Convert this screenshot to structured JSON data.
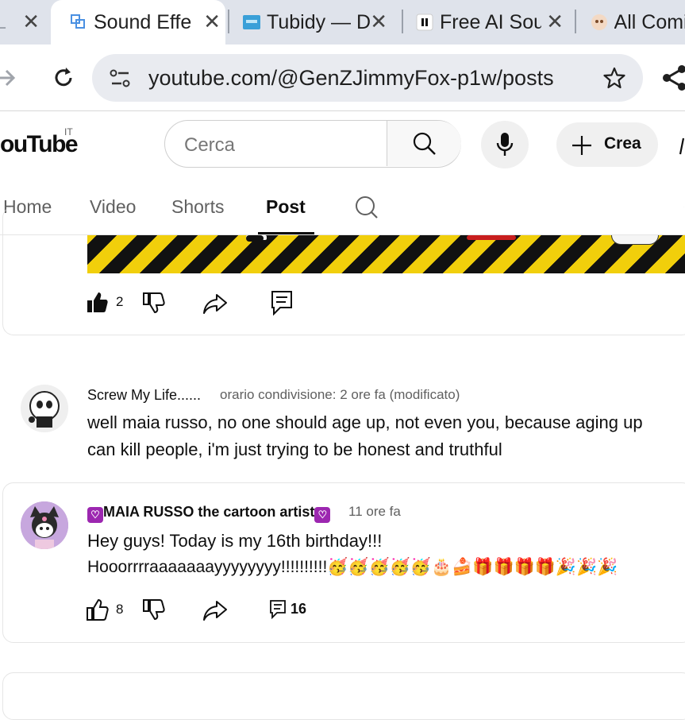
{
  "browser": {
    "tabs": [
      {
        "label": "L",
        "favicon": "partial-tab-icon"
      },
      {
        "label": "Sound Effe",
        "favicon": "sound-effects-favicon"
      },
      {
        "label": "Tubidy — D",
        "favicon": "tubidy-favicon"
      },
      {
        "label": "Free AI Sou",
        "favicon": "pause-favicon"
      },
      {
        "label": "All Comi",
        "favicon": "all-comics-favicon"
      }
    ],
    "close_glyph": "✕",
    "url": "youtube.com/@GenZJimmyFox-p1w/posts"
  },
  "youtube": {
    "logo_text": "ouTube",
    "country_code": "IT",
    "search_placeholder": "Cerca",
    "create_label": "Crea"
  },
  "channel_tabs": [
    {
      "label": "Home",
      "active": false
    },
    {
      "label": "Video",
      "active": false
    },
    {
      "label": "Shorts",
      "active": false
    },
    {
      "label": "Post",
      "active": true
    }
  ],
  "posts": [
    {
      "likes": "2"
    },
    {
      "author": "Screw My Life......",
      "meta": "orario condivisione: 2 ore fa (modificato)",
      "lines": [
        "well maia russo, no one should age up, not even you, because aging up",
        "can kill people, i'm just trying to be honest and truthful"
      ]
    },
    {
      "author": "MAIA RUSSO the cartoon artist",
      "meta": "11 ore fa",
      "lines": [
        "Hey guys! Today is my 16th birthday!!!",
        "Hooorrrraaaaaaayyyyyyyy!!!!!!!!!!🥳🥳🥳🥳🥳🎂🍰🎁🎁🎁🎁🎉🎉🎉"
      ],
      "likes": "8",
      "comments": "16"
    }
  ],
  "colors": {
    "tabstrip": "#dfe3eb",
    "omnibox": "#e9ebf0",
    "stripe_yellow": "#f1cf0b",
    "stripe_black": "#111111",
    "heart_badge": "#9c27b0"
  }
}
